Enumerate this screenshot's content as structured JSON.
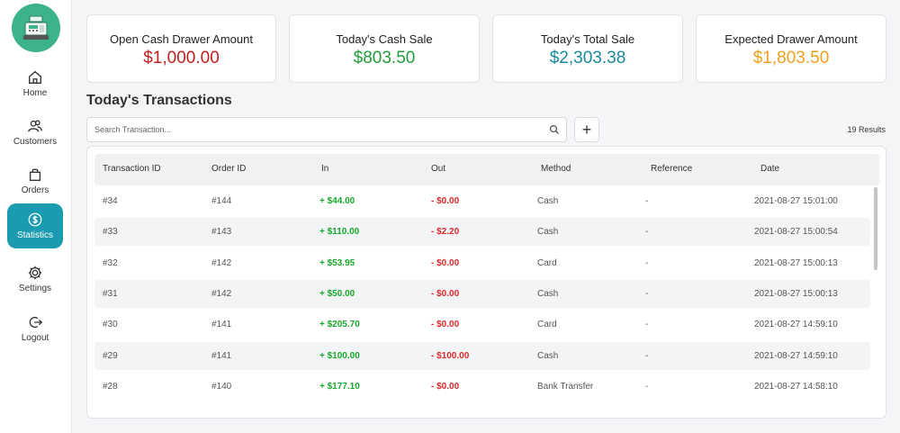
{
  "colors": {
    "accent": "#1a9bb0",
    "red": "#c41f1f",
    "green": "#1f9d3a",
    "teal": "#198a9e",
    "orange": "#f0a01e"
  },
  "sidebar": {
    "logo_icon": "cash-register-icon",
    "items": [
      {
        "label": "Home",
        "icon": "home-icon"
      },
      {
        "label": "Customers",
        "icon": "users-icon"
      },
      {
        "label": "Orders",
        "icon": "bag-icon"
      },
      {
        "label": "Statistics",
        "icon": "dollar-icon"
      },
      {
        "label": "Settings",
        "icon": "gear-icon"
      },
      {
        "label": "Logout",
        "icon": "logout-icon"
      }
    ]
  },
  "cards": [
    {
      "title": "Open Cash Drawer Amount",
      "value": "$1,000.00"
    },
    {
      "title": "Today's Cash Sale",
      "value": "$803.50"
    },
    {
      "title": "Today's Total Sale",
      "value": "$2,303.38"
    },
    {
      "title": "Expected Drawer Amount",
      "value": "$1,803.50"
    }
  ],
  "transactions": {
    "title": "Today's Transactions",
    "search_placeholder": "Search Transaction...",
    "results": "19 Results",
    "add_label": "+",
    "columns": [
      "Transaction ID",
      "Order ID",
      "In",
      "Out",
      "Method",
      "Reference",
      "Date"
    ],
    "rows": [
      [
        "#34",
        "#144",
        "+ $44.00",
        "- $0.00",
        "Cash",
        "-",
        "2021-08-27 15:01:00"
      ],
      [
        "#33",
        "#143",
        "+ $110.00",
        "- $2.20",
        "Cash",
        "-",
        "2021-08-27 15:00:54"
      ],
      [
        "#32",
        "#142",
        "+ $53.95",
        "- $0.00",
        "Card",
        "-",
        "2021-08-27 15:00:13"
      ],
      [
        "#31",
        "#142",
        "+ $50.00",
        "- $0.00",
        "Cash",
        "-",
        "2021-08-27 15:00:13"
      ],
      [
        "#30",
        "#141",
        "+ $205.70",
        "- $0.00",
        "Card",
        "-",
        "2021-08-27 14:59:10"
      ],
      [
        "#29",
        "#141",
        "+ $100.00",
        "- $100.00",
        "Cash",
        "-",
        "2021-08-27 14:59:10"
      ],
      [
        "#28",
        "#140",
        "+ $177.10",
        "- $0.00",
        "Bank Transfer",
        "-",
        "2021-08-27 14:58:10"
      ]
    ]
  }
}
